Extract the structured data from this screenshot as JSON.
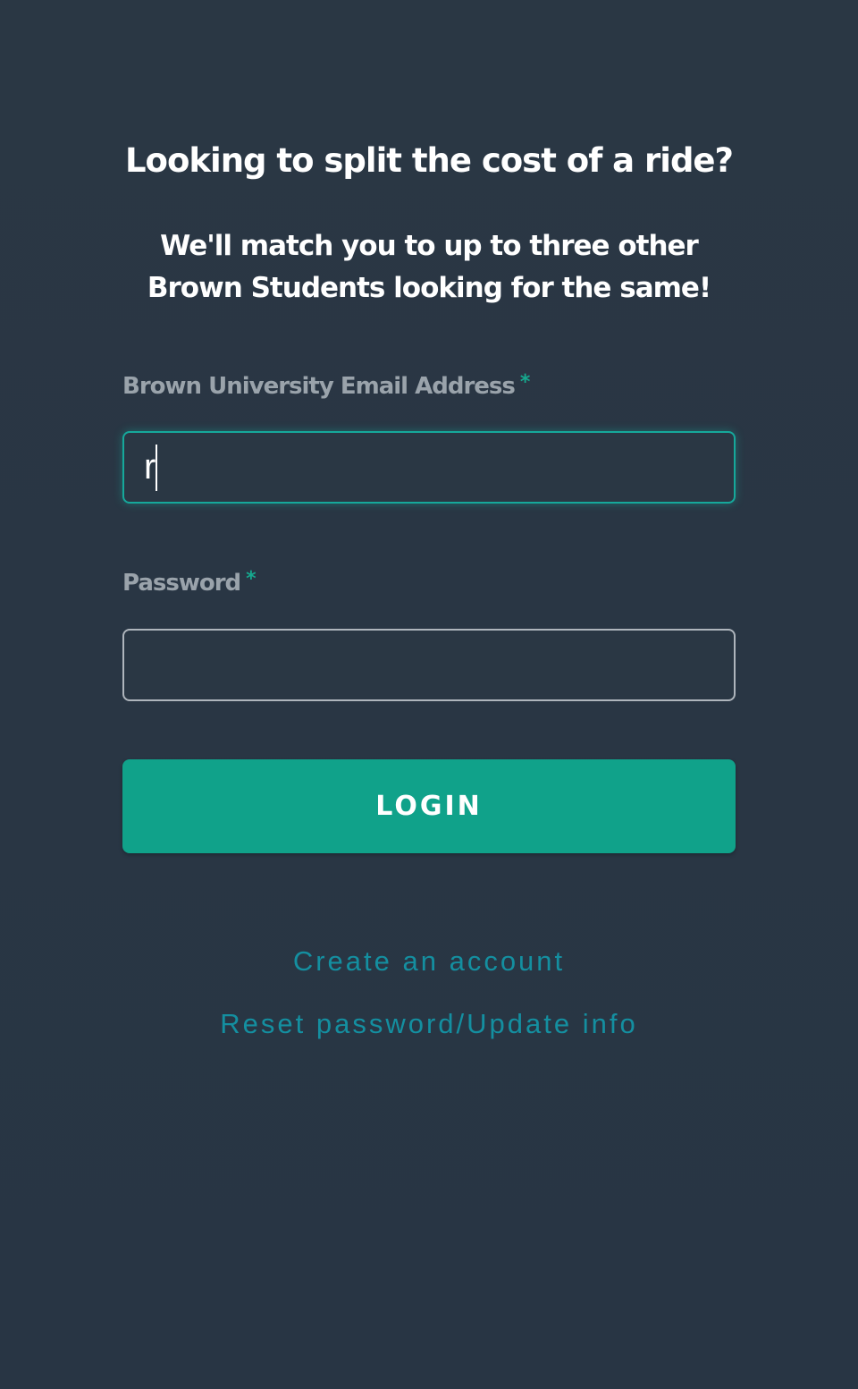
{
  "hero": {
    "title": "Looking to split the cost of a ride?",
    "subtitle": "We'll match you to up to three other Brown Students looking for the same!"
  },
  "form": {
    "email": {
      "label": "Brown University Email Address",
      "required_marker": "*",
      "value": "r",
      "focused": true
    },
    "password": {
      "label": "Password",
      "required_marker": "*",
      "value": ""
    },
    "login_label": "LOGIN"
  },
  "links": {
    "create_account": "Create an account",
    "reset_password": "Reset password/Update info"
  },
  "colors": {
    "background": "#2a3744",
    "accent": "#10a28a",
    "link": "#148fa0",
    "label": "#9aa3ab",
    "focus_border": "#16a89b"
  }
}
